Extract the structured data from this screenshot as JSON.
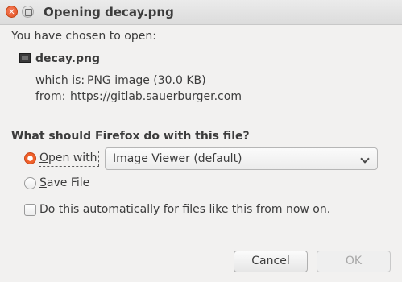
{
  "window": {
    "title": "Opening decay.png"
  },
  "dialog": {
    "intro": "You have chosen to open:",
    "file_name": "decay.png",
    "which_is_label": "which is:",
    "which_is_value": "PNG image (30.0 KB)",
    "from_label": "from:",
    "from_value": "https://gitlab.sauerburger.com",
    "question": "What should Firefox do with this file?"
  },
  "options": {
    "open_with_label": "Open with",
    "open_with_app": "Image Viewer (default)",
    "save_file_label": "Save File",
    "auto_label": "Do this automatically for files like this from now on.",
    "open_with_checked": true,
    "save_file_checked": false,
    "auto_checked": false
  },
  "buttons": {
    "cancel": "Cancel",
    "ok": "OK"
  },
  "icons": {
    "close": "close-icon",
    "minimize": "minimize-icon",
    "file": "image-file-icon",
    "dropdown": "chevron-down-icon"
  },
  "colors": {
    "accent": "#f0602a",
    "background": "#f2f1f0",
    "text": "#3c3c3c"
  }
}
